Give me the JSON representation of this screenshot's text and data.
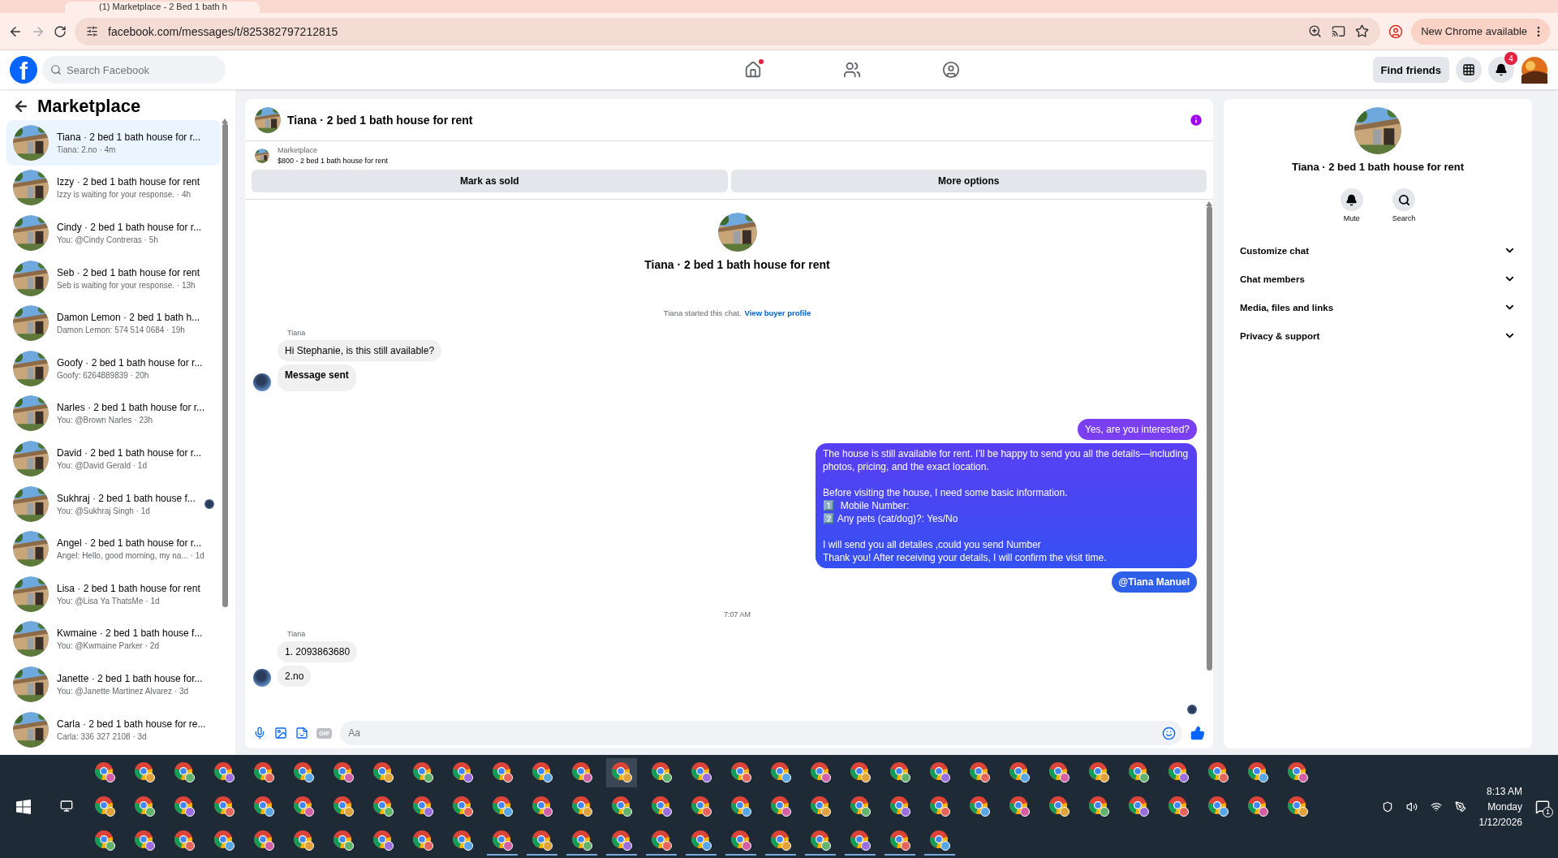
{
  "browser": {
    "tab_title": "(1) Marketplace - 2 Bed 1 bath h",
    "url": "facebook.com/messages/t/825382797212815",
    "update_label": "New Chrome available"
  },
  "header": {
    "logo_letter": "f",
    "search_placeholder": "Search Facebook",
    "find_friends": "Find friends",
    "notification_count": "4",
    "nav": [
      {
        "kind": "home",
        "selected": false,
        "dot": true
      },
      {
        "kind": "friends",
        "selected": false,
        "dot": false
      },
      {
        "kind": "groups",
        "selected": false,
        "dot": false
      }
    ]
  },
  "sidebar": {
    "title": "Marketplace",
    "items": [
      {
        "title": "Tiana · 2 bed 1 bath house for r...",
        "preview": "Tiana: 2.no · 4m",
        "selected": true,
        "seen": false
      },
      {
        "title": "Izzy · 2 bed 1 bath house for rent",
        "preview": "Izzy is waiting for your response. · 4h",
        "selected": false,
        "seen": false
      },
      {
        "title": "Cindy · 2 bed 1 bath house for r...",
        "preview": "You: @Cindy Contreras · 5h",
        "selected": false,
        "seen": false
      },
      {
        "title": "Seb · 2 bed 1 bath house for rent",
        "preview": "Seb is waiting for your response. · 13h",
        "selected": false,
        "seen": false
      },
      {
        "title": "Damon Lemon · 2 bed 1 bath h...",
        "preview": "Damon Lemon: 574 514 0684 · 19h",
        "selected": false,
        "seen": false
      },
      {
        "title": "Goofy · 2 bed 1 bath house for r...",
        "preview": "Goofy: 6264889839 · 20h",
        "selected": false,
        "seen": false
      },
      {
        "title": "Narles · 2 bed 1 bath house for r...",
        "preview": "You: @Brown Narles · 23h",
        "selected": false,
        "seen": false
      },
      {
        "title": "David · 2 bed 1 bath house for r...",
        "preview": "You: @David Gerald · 1d",
        "selected": false,
        "seen": false
      },
      {
        "title": "Sukhraj · 2 bed 1 bath house f...",
        "preview": "You: @Sukhraj Singh · 1d",
        "selected": false,
        "seen": true
      },
      {
        "title": "Angel · 2 bed 1 bath house for r...",
        "preview": "Angel: Hello, good morning, my na... · 1d",
        "selected": false,
        "seen": false
      },
      {
        "title": "Lisa · 2 bed 1 bath house for rent",
        "preview": "You: @Lisa Ya ThatsMe · 1d",
        "selected": false,
        "seen": false
      },
      {
        "title": "Kwmaine · 2 bed 1 bath house f...",
        "preview": "You: @Kwmaine Parker · 2d",
        "selected": false,
        "seen": false
      },
      {
        "title": "Janette · 2 bed 1 bath house for...",
        "preview": "You: @Janette Martinez Alvarez · 3d",
        "selected": false,
        "seen": false
      },
      {
        "title": "Carla · 2 bed 1 bath house for re...",
        "preview": "Carla: 336 327 2108 · 3d",
        "selected": false,
        "seen": false
      }
    ]
  },
  "chat": {
    "title": "Tiana · 2 bed 1 bath house for rent",
    "listing": {
      "source": "Marketplace",
      "summary": "$800 - 2 bed 1 bath house for rent"
    },
    "actions": [
      "Mark as sold",
      "More options"
    ],
    "intro": {
      "title": "Tiana · 2 bed 1 bath house for rent",
      "notice": "Tiana started this chat.",
      "link": "View buyer profile"
    },
    "messages": [
      {
        "kind": "incoming",
        "sender": "Tiana",
        "bubbles": [
          {
            "text": "Hi Stephanie, is this still available?",
            "bold": false
          },
          {
            "text": "Message sent",
            "bold": true
          }
        ]
      },
      {
        "kind": "outgoing",
        "bubbles": [
          {
            "text": "Yes, are you interested?",
            "bold": false
          },
          {
            "text": "The house is still available for rent. I’ll be happy to send you all the details—including photos, pricing, and the exact location.\n\nBefore visiting the house, I need some basic information.\n1️⃣  Mobile Number:\n2️⃣ Any pets (cat/dog)?: Yes/No\n\nI will send you all detailes ,could you send Number\nThank you! After receiving your details, I will confirm the visit time.",
            "bold": false
          },
          {
            "text": "@Tiana Manuel",
            "bold": true
          }
        ]
      },
      {
        "kind": "time",
        "text": "7:07 AM"
      },
      {
        "kind": "incoming",
        "sender": "Tiana",
        "bubbles": [
          {
            "text": "1. 2093863680",
            "bold": false
          },
          {
            "text": "2.no",
            "bold": false
          }
        ]
      }
    ],
    "composer": {
      "placeholder": "Aa",
      "gif_label": "GIF"
    }
  },
  "details": {
    "title": "Tiana · 2 bed 1 bath house for rent",
    "actions": [
      {
        "kind": "mute",
        "label": "Mute"
      },
      {
        "kind": "search",
        "label": "Search"
      }
    ],
    "sections": [
      {
        "label": "Customize chat",
        "expanded": false
      },
      {
        "label": "Chat members",
        "expanded": false
      },
      {
        "label": "Media, files and links",
        "expanded": false
      },
      {
        "label": "Privacy & support",
        "expanded": false
      }
    ]
  },
  "taskbar": {
    "time": "8:13 AM",
    "day": "Monday",
    "date": "1/12/2026",
    "notification_count": "1"
  }
}
